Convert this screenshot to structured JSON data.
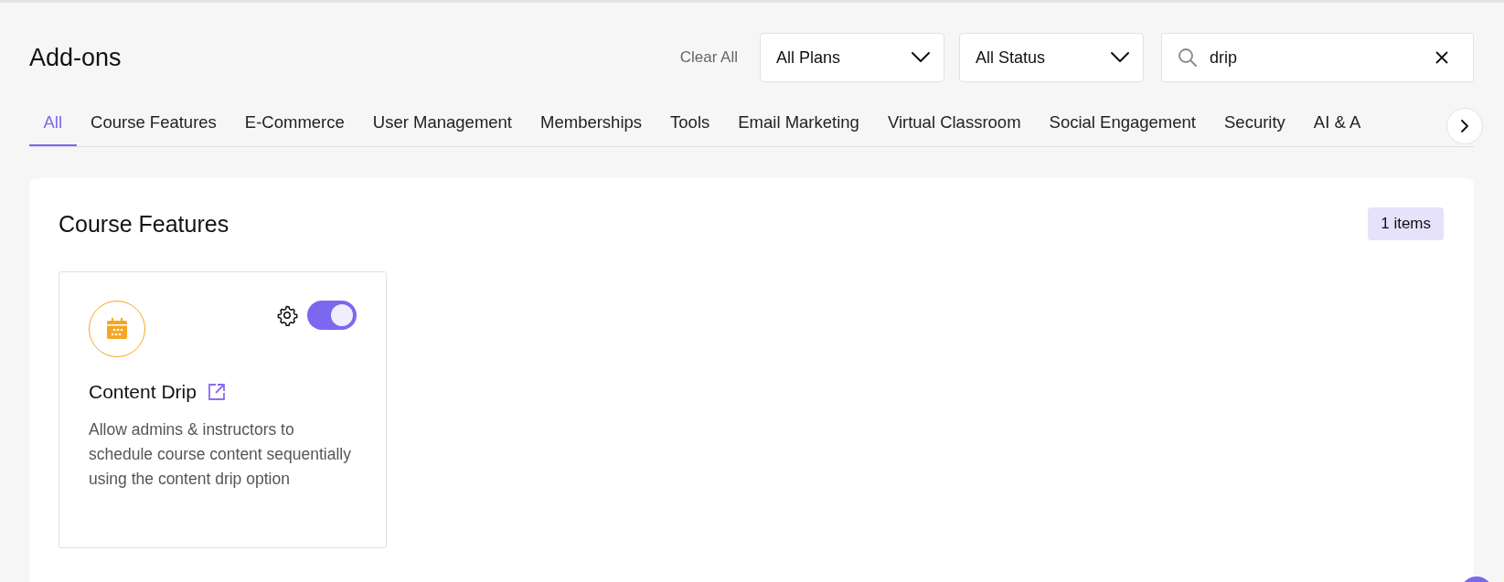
{
  "page": {
    "title": "Add-ons"
  },
  "filters": {
    "clear_label": "Clear All",
    "dropdowns": [
      {
        "value": "All Plans"
      },
      {
        "value": "All Status"
      }
    ],
    "search": {
      "value": "drip"
    }
  },
  "tabs": [
    {
      "label": "All",
      "selected": true
    },
    {
      "label": "Course Features",
      "selected": false
    },
    {
      "label": "E-Commerce",
      "selected": false
    },
    {
      "label": "User Management",
      "selected": false
    },
    {
      "label": "Memberships",
      "selected": false
    },
    {
      "label": "Tools",
      "selected": false
    },
    {
      "label": "Email Marketing",
      "selected": false
    },
    {
      "label": "Virtual Classroom",
      "selected": false
    },
    {
      "label": "Social Engagement",
      "selected": false
    },
    {
      "label": "Security",
      "selected": false
    },
    {
      "label": "AI & A",
      "selected": false
    }
  ],
  "sections": [
    {
      "title": "Course Features",
      "count": "1 items",
      "addons": [
        {
          "name": "Content Drip",
          "description": "Allow admins & instructors to schedule course content sequentially using the content drip option",
          "on": true
        }
      ]
    }
  ]
}
